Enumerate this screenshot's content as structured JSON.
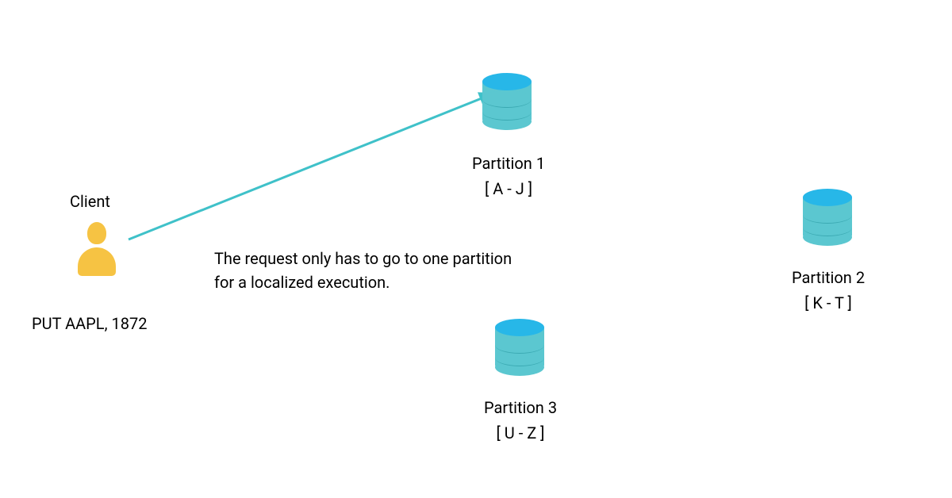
{
  "client": {
    "label": "Client",
    "request": "PUT AAPL, 1872"
  },
  "description": "The request only has to go to one partition for a localized execution.",
  "partitions": {
    "p1": {
      "title": "Partition 1",
      "range": "[ A - J ]"
    },
    "p2": {
      "title": "Partition 2",
      "range": "[ K - T ]"
    },
    "p3": {
      "title": "Partition 3",
      "range": "[ U - Z ]"
    }
  },
  "colors": {
    "arrow": "#3fc1c9",
    "db_side": "#5bc7d0",
    "db_top": "#27b7e8",
    "person": "#f6c343"
  }
}
